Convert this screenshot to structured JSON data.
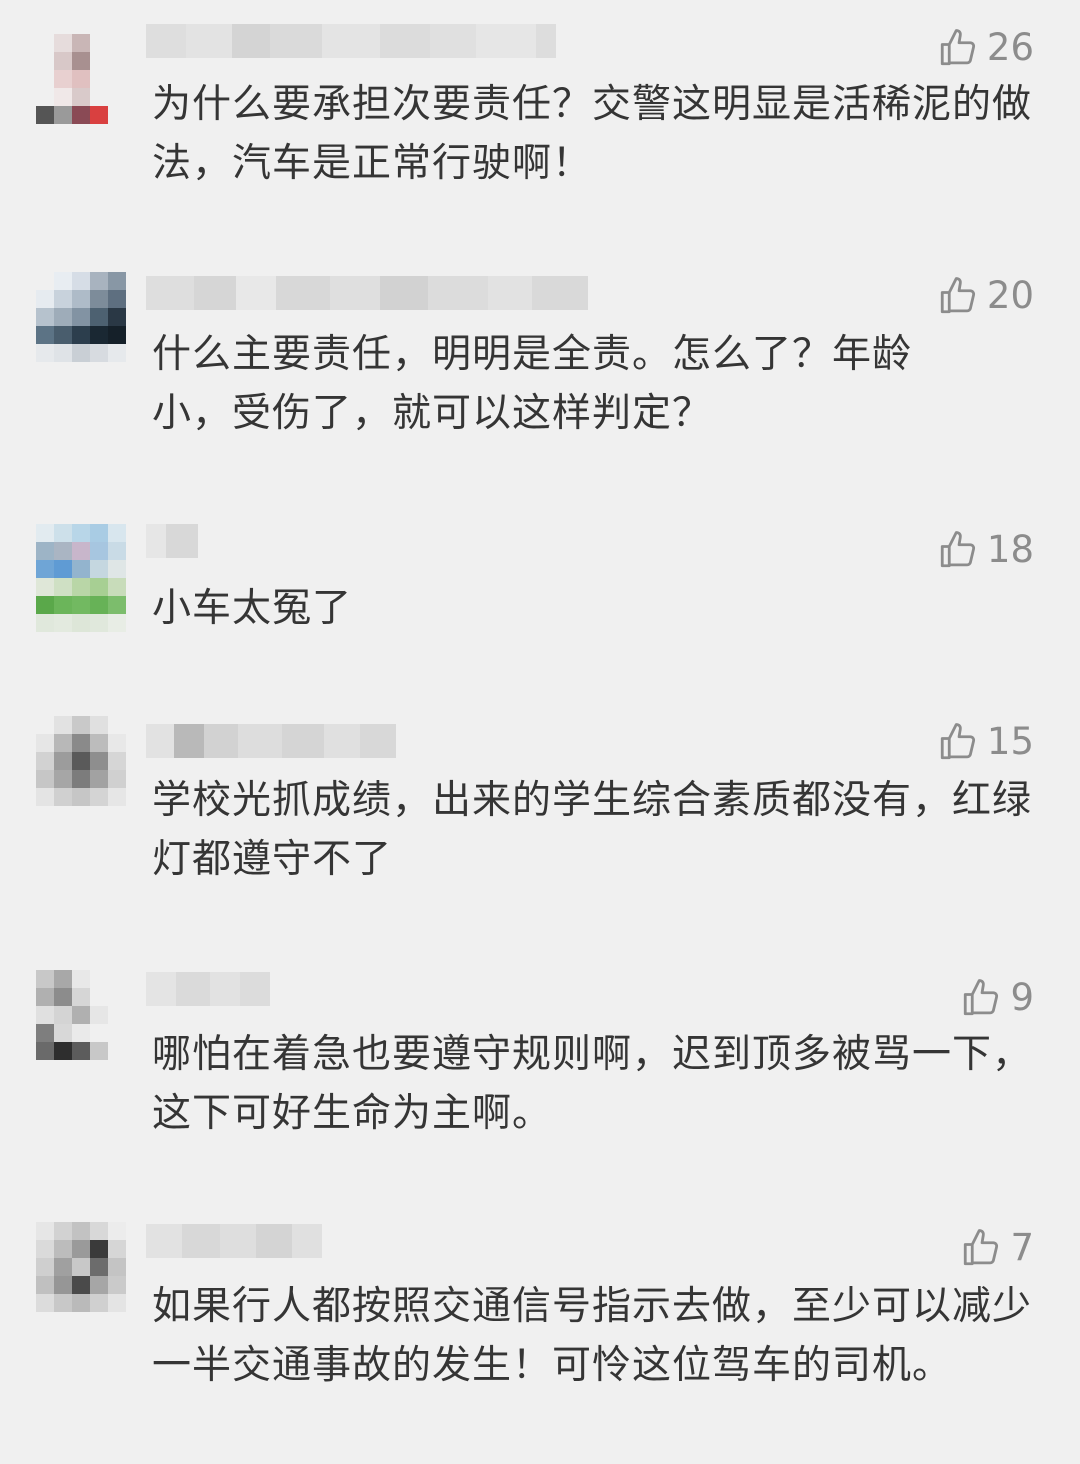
{
  "comments": [
    {
      "likes": "26",
      "text": "为什么要承担次要责任？交警这明显是活稀泥的做法，汽车是正常行驶啊！"
    },
    {
      "likes": "20",
      "text": "什么主要责任，明明是全责。怎么了？年龄小，受伤了，就可以这样判定？"
    },
    {
      "likes": "18",
      "text": "小车太冤了"
    },
    {
      "likes": "15",
      "text": "学校光抓成绩，出来的学生综合素质都没有，红绿灯都遵守不了"
    },
    {
      "likes": "9",
      "text": "哪怕在着急也要遵守规则啊，迟到顶多被骂一下，这下可好生命为主啊。"
    },
    {
      "likes": "7",
      "text": "如果行人都按照交通信号指示去做，至少可以减少一半交通事故的发生！可怜这位驾车的司机。"
    }
  ],
  "icons": {
    "like": "thumbs-up-icon"
  },
  "colors": {
    "background": "#f0f0f0",
    "text": "#353535",
    "like": "#8c8c8c"
  }
}
